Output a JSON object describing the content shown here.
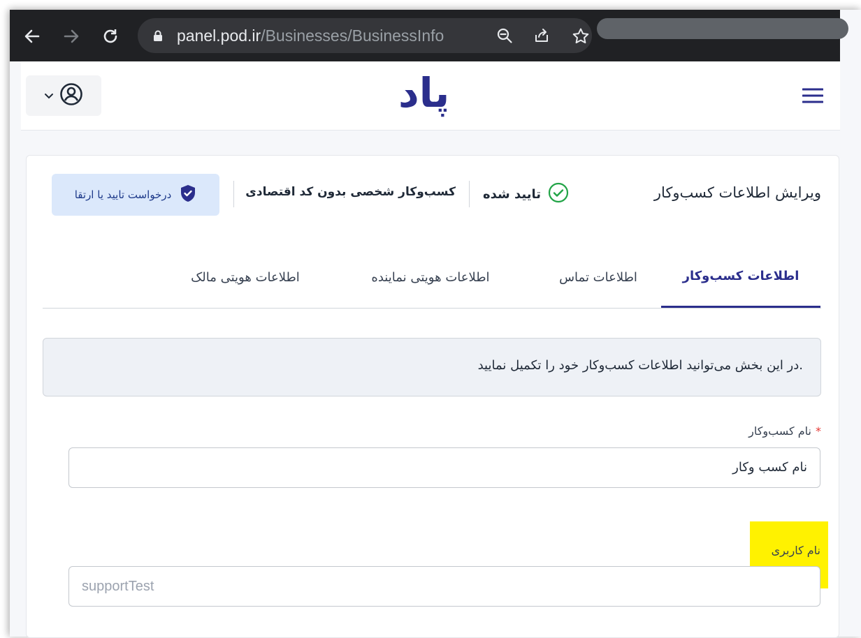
{
  "browser": {
    "url_host": "panel.pod.ir",
    "url_path": "/Businesses/BusinessInfo"
  },
  "header": {
    "brand": "پاد",
    "user_menu_icon": "user-circle-icon",
    "menu_icon": "hamburger-icon"
  },
  "page": {
    "title": "ویرایش اطلاعات کسب‌وکار",
    "status_label": "تایید شده",
    "business_type": "کسب‌وکار شخصی بدون کد اقتصادی",
    "upgrade_button": "درخواست تایید یا ارتقا"
  },
  "tabs": [
    {
      "label": "اطلاعات کسب‌وکار",
      "active": true
    },
    {
      "label": "اطلاعات تماس",
      "active": false
    },
    {
      "label": "اطلاعات هویتی نماینده",
      "active": false
    },
    {
      "label": "اطلاعات هویتی مالک",
      "active": false
    }
  ],
  "info_message": "در این بخش می‌توانید اطلاعات کسب‌وکار خود را تکمیل نمایید.",
  "form": {
    "business_name_label": "نام کسب‌وکار",
    "business_name_required": "*",
    "business_name_value": "نام کسب وکار",
    "username_label": "نام کاربری",
    "username_value": "supportTest"
  },
  "colors": {
    "brand": "#2b2e8c",
    "success": "#22a447",
    "highlight": "#fff200"
  }
}
